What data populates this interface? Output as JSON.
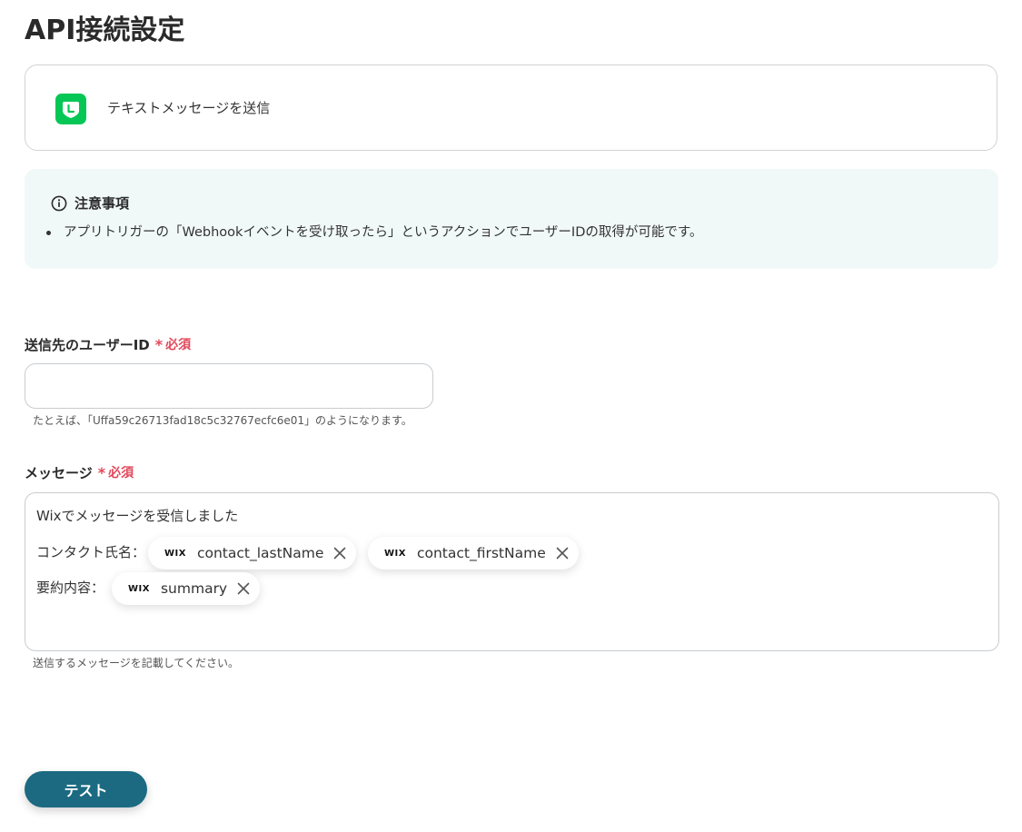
{
  "page": {
    "title": "API接続設定"
  },
  "action": {
    "icon": "line-app-icon",
    "label": "テキストメッセージを送信",
    "icon_color": "#06c755"
  },
  "notice": {
    "icon": "info-icon",
    "title": "注意事項",
    "items": [
      "アプリトリガーの「Webhookイベントを受け取ったら」というアクションでユーザーIDの取得が可能です。"
    ],
    "background": "#f1f9f8"
  },
  "user_id_field": {
    "label": "送信先のユーザーID",
    "required_star": "*",
    "required_label": "必須",
    "value": "",
    "help": "たとえば、「Uffa59c26713fad18c5c32767ecfc6e01」のようになります。"
  },
  "message_field": {
    "label": "メッセージ",
    "required_star": "*",
    "required_label": "必須",
    "lines": {
      "first": "Wixでメッセージを受信しました",
      "contact_prefix": "コンタクト氏名：",
      "summary_prefix": "要約内容："
    },
    "chips": [
      {
        "source": "WIX",
        "label": "contact_lastName",
        "icon": "wix-icon"
      },
      {
        "source": "WIX",
        "label": "contact_firstName",
        "icon": "wix-icon"
      },
      {
        "source": "WIX",
        "label": "summary",
        "icon": "wix-icon"
      }
    ],
    "help": "送信するメッセージを記載してください。"
  },
  "test_button": {
    "label": "テスト",
    "color": "#1b6a82"
  },
  "colors": {
    "required": "#e2485b",
    "border": "#c8ccd0"
  }
}
